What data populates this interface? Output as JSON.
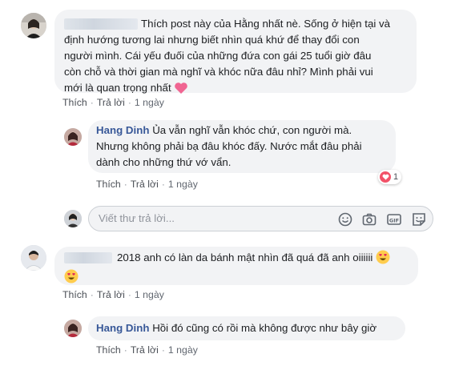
{
  "comment1": {
    "text_line1": "Thích post này của Hằng nhất nè. Sống ở hiện tại và",
    "text_line2": "định hướng tương lai nhưng biết nhìn quá khứ để thay đổi con",
    "text_line3": "người mình. Cái yếu đuối của những đứa con gái 25 tuổi giờ đâu",
    "text_line4": "còn chỗ và thời gian mà nghĩ và khóc nữa đâu nhỉ? Mình phải vui",
    "text_line5": "mới là quan trọng nhất",
    "like": "Thích",
    "reply": "Trả lời",
    "time": "1 ngày"
  },
  "reply1": {
    "author": "Hang Dinh",
    "text_line1": "Ủa vẫn nghĩ vẫn khóc chứ, con người mà.",
    "text_line2": "Nhưng không phải bạ đâu khóc đấy. Nước mắt đâu phải",
    "text_line3": "dành cho những thứ vớ vẩn.",
    "reaction_count": "1",
    "like": "Thích",
    "reply": "Trả lời",
    "time": "1 ngày"
  },
  "reply_box": {
    "placeholder": "Viết thư trả lời...",
    "icons": [
      "smiley-icon",
      "camera-icon",
      "gif-icon",
      "sticker-icon"
    ]
  },
  "comment2": {
    "text_line1": "2018 anh có làn da bánh mật nhìn đã quá đã anh oiiiiii",
    "like": "Thích",
    "reply": "Trả lời",
    "time": "1 ngày"
  },
  "reply2": {
    "author": "Hang Dinh",
    "text": "Hồi đó cũng có rồi mà không được như bây giờ",
    "like": "Thích",
    "reply": "Trả lời",
    "time": "1 ngày"
  },
  "colors": {
    "name": "#385898",
    "bubble": "#f2f3f5",
    "meta": "#616770",
    "heart": "#f25268",
    "icon": "#606770"
  }
}
